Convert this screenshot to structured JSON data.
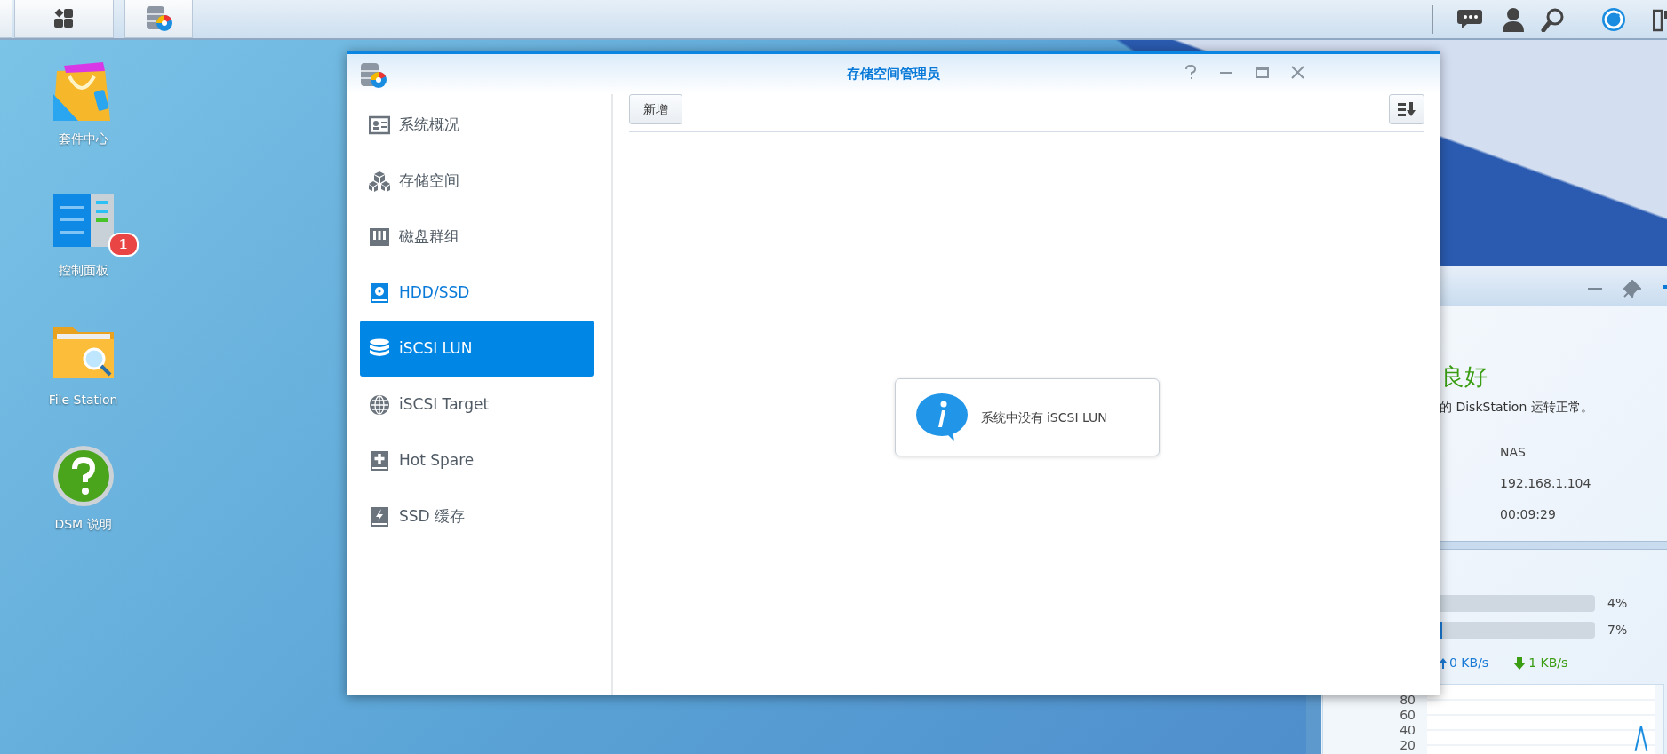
{
  "desktop_icons": [
    {
      "label": "套件中心",
      "kind": "package"
    },
    {
      "label": "控制面板",
      "kind": "control",
      "badge": "1"
    },
    {
      "label": "File Station",
      "kind": "folder"
    },
    {
      "label": "DSM 说明",
      "kind": "help"
    }
  ],
  "window": {
    "title": "存储空间管理员",
    "sidebar": [
      {
        "label": "系统概况",
        "kind": "overview",
        "selected": false,
        "hovered": false
      },
      {
        "label": "存储空间",
        "kind": "volume",
        "selected": false,
        "hovered": false
      },
      {
        "label": "磁盘群组",
        "kind": "group",
        "selected": false,
        "hovered": false
      },
      {
        "label": "HDD/SSD",
        "kind": "disk",
        "selected": false,
        "hovered": true
      },
      {
        "label": "iSCSI LUN",
        "kind": "lun",
        "selected": true,
        "hovered": false
      },
      {
        "label": "iSCSI Target",
        "kind": "target",
        "selected": false,
        "hovered": false
      },
      {
        "label": "Hot Spare",
        "kind": "spare",
        "selected": false,
        "hovered": false
      },
      {
        "label": "SSD 缓存",
        "kind": "cache",
        "selected": false,
        "hovered": false
      }
    ],
    "toolbar": {
      "buttons": [
        "新增"
      ]
    },
    "empty_message": "系统中没有 iSCSI LUN"
  },
  "widget": {
    "status": "良好",
    "message": "的 DiskStation 运转正常。",
    "info": [
      "NAS",
      "192.168.1.104",
      "00:09:29"
    ],
    "meters": [
      {
        "reading": "4%"
      },
      {
        "reading": "7%",
        "level": 0.07
      }
    ],
    "upload": "0 KB/s",
    "download": "1 KB/s",
    "chart_data": {
      "type": "line",
      "ylim": [
        0,
        100
      ],
      "yticks": [
        20,
        40,
        60,
        80
      ],
      "grid": true,
      "series": [
        {
          "color": "#1a8de0",
          "values": [
            null,
            null,
            null,
            null,
            null,
            null,
            null,
            null,
            null,
            null,
            null,
            null,
            null,
            null,
            null,
            null,
            null,
            null,
            null,
            null,
            null,
            null,
            null,
            null,
            null,
            null,
            null,
            null,
            null,
            null,
            null,
            null,
            null,
            null,
            null,
            null,
            12,
            45,
            12,
            null
          ]
        }
      ]
    }
  }
}
